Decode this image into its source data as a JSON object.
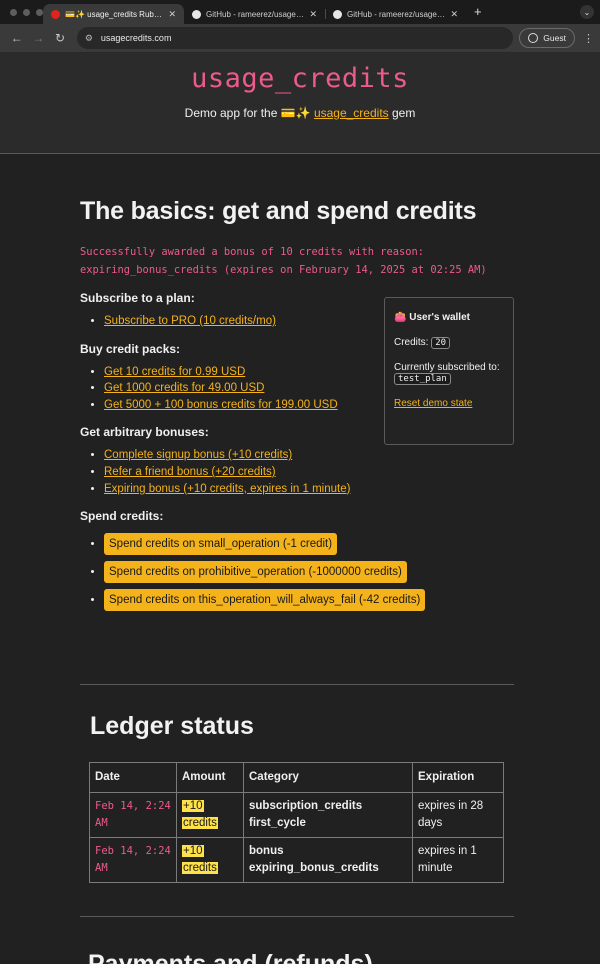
{
  "browser": {
    "tabs": [
      {
        "title": "💳✨ usage_credits Ruby gem",
        "active": true
      },
      {
        "title": "GitHub - rameerez/usage_credits",
        "active": false
      },
      {
        "title": "GitHub - rameerez/usage_credits",
        "active": false
      }
    ],
    "url": "usagecredits.com",
    "profile_label": "Guest"
  },
  "header": {
    "title": "usage_credits",
    "tagline_prefix": "Demo app for the 💳✨",
    "tagline_link": "usage_credits",
    "tagline_suffix": "gem"
  },
  "basics": {
    "heading": "The basics: get and spend credits",
    "flash": "Successfully awarded a bonus of 10 credits with reason: expiring_bonus_credits (expires on February 14, 2025 at 02:25 AM)",
    "subscribe_label": "Subscribe to a plan:",
    "subscribe_links": [
      "Subscribe to PRO (10 credits/mo)"
    ],
    "packs_label": "Buy credit packs:",
    "pack_links": [
      "Get 10 credits for 0.99 USD",
      "Get 1000 credits for 49.00 USD",
      "Get 5000 + 100 bonus credits for 199.00 USD"
    ],
    "bonuses_label": "Get arbitrary bonuses:",
    "bonus_links": [
      "Complete signup bonus (+10 credits)",
      "Refer a friend bonus (+20 credits)",
      "Expiring bonus (+10 credits, expires in 1 minute)"
    ],
    "spend_label": "Spend credits:",
    "spend_buttons": [
      "Spend credits on small_operation (-1 credit)",
      "Spend credits on prohibitive_operation (-1000000 credits)",
      "Spend credits on this_operation_will_always_fail (-42 credits)"
    ]
  },
  "wallet": {
    "title": "User's wallet",
    "credits_label": "Credits:",
    "credits_value": "20",
    "subscribed_label": "Currently subscribed to:",
    "plan_value": "test_plan",
    "reset_link": "Reset demo state"
  },
  "ledger": {
    "heading": "Ledger status",
    "columns": [
      "Date",
      "Amount",
      "Category",
      "Expiration"
    ],
    "rows": [
      {
        "date": "Feb 14, 2:24 AM",
        "amount": "+10 credits",
        "category1": "subscription_credits",
        "category2": "first_cycle",
        "expiration": "expires in 28 days"
      },
      {
        "date": "Feb 14, 2:24 AM",
        "amount": "+10 credits",
        "category1": "bonus",
        "category2": "expiring_bonus_credits",
        "expiration": "expires in 1 minute"
      }
    ]
  },
  "next_section": {
    "heading": "Payments and (refunds)"
  }
}
